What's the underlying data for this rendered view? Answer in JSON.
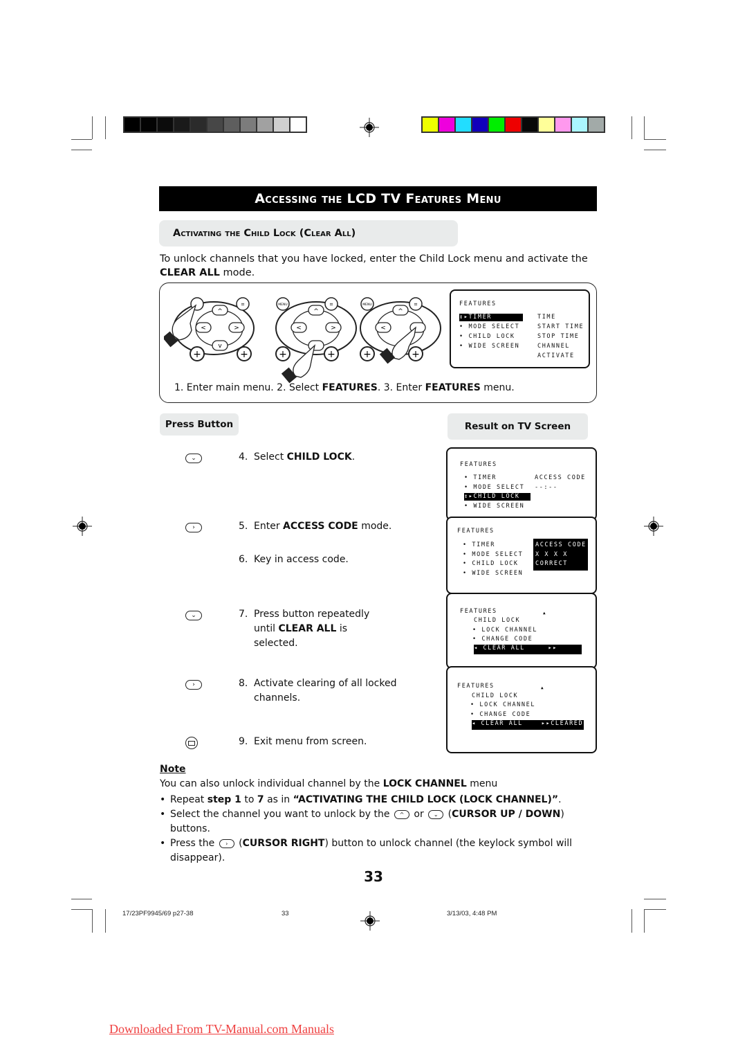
{
  "header": {
    "title": "Accessing the LCD TV Features Menu",
    "subtitle": "Activating the Child Lock (Clear All)"
  },
  "colors": {
    "grayscale_bar": [
      "#000000",
      "#030303",
      "#0c0c0c",
      "#1a1a1a",
      "#2b2b2b",
      "#474747",
      "#5e5e5e",
      "#7c7c7c",
      "#a1a1a1",
      "#cfcfcf",
      "#ffffff"
    ],
    "color_bar": [
      "#eeff00",
      "#ee00dd",
      "#22ddff",
      "#1100bb",
      "#00ee00",
      "#ee0000",
      "#080808",
      "#ffff99",
      "#ff99ee",
      "#aaf5ff",
      "#a2aaa8"
    ],
    "link": "#ef4040"
  },
  "intro": {
    "text": "To unlock channels that you have locked, enter the Child Lock menu and activate the",
    "bold": "CLEAR ALL",
    "suffix": " mode."
  },
  "setup_steps": {
    "remote_labels": {
      "menu": "MENU"
    },
    "caption": [
      {
        "pre": "1. Enter main menu.   2. Select ",
        "bold": "FEATURES",
        "post": ".   3. Enter "
      },
      {
        "bold": "FEATURES",
        "post": " menu."
      }
    ],
    "osd": {
      "title": "FEATURES",
      "items": [
        "TIMER",
        "MODE SELECT",
        "CHILD LOCK",
        "WIDE SCREEN"
      ],
      "selected": "TIMER",
      "sub_items": [
        "TIME",
        "START TIME",
        "STOP TIME",
        "CHANNEL",
        "ACTIVATE"
      ]
    }
  },
  "columns": {
    "press_button": "Press Button",
    "result": "Result on TV Screen"
  },
  "steps": [
    {
      "num": "4.",
      "pre": "Select ",
      "bold": "CHILD LOCK",
      "post": ".",
      "icon": "cursor-down"
    },
    {
      "num": "5.",
      "pre": "Enter ",
      "bold": "ACCESS CODE",
      "post": " mode.",
      "icon": "cursor-right"
    },
    {
      "num": "6.",
      "pre": "Key in access code.",
      "bold": "",
      "post": "",
      "icon": ""
    },
    {
      "num": "7.",
      "pre": "Press button repeatedly until ",
      "bold": "CLEAR ALL",
      "post": " is selected.",
      "icon": "cursor-down"
    },
    {
      "num": "8.",
      "pre": "Activate clearing of all locked channels.",
      "bold": "",
      "post": "",
      "icon": "cursor-right"
    },
    {
      "num": "9.",
      "pre": "Exit menu from screen.",
      "bold": "",
      "post": "",
      "icon": "osd-exit"
    }
  ],
  "screens": [
    {
      "title": "FEATURES",
      "items": [
        "• TIMER",
        "• MODE SELECT",
        "CHILD LOCK",
        "• WIDE SCREEN"
      ],
      "selected": "CHILD LOCK",
      "right": [
        "ACCESS CODE",
        "--:--"
      ]
    },
    {
      "title": "FEATURES",
      "items": [
        "• TIMER",
        "• MODE SELECT",
        "• CHILD LOCK",
        "• WIDE SCREEN"
      ],
      "right": [
        "ACCESS CODE",
        "X X X X",
        "CORRECT"
      ]
    },
    {
      "title": "FEATURES",
      "heading": "CHILD LOCK",
      "items": [
        "• LOCK CHANNEL",
        "• CHANGE CODE"
      ],
      "selected": "CLEAR ALL",
      "selected_suffix": "",
      "marker": "▲"
    },
    {
      "title": "FEATURES",
      "heading": "CHILD LOCK",
      "items": [
        "• LOCK CHANNEL",
        "• CHANGE CODE"
      ],
      "selected": "CLEAR ALL",
      "selected_suffix": "CLEARED",
      "marker": "▲"
    }
  ],
  "note": {
    "heading": "Note",
    "text_pre": "You can also unlock individual channel by the ",
    "text_bold": "LOCK CHANNEL",
    "text_post": " menu",
    "bullets": [
      {
        "p1": "Repeat ",
        "b1": "step 1",
        "p2": " to ",
        "b2": "7",
        "p3": " as in ",
        "b3": "“ACTIVATING THE CHILD LOCK (LOCK CHANNEL)”",
        "p4": "."
      },
      {
        "p1": "Select the channel you want to unlock by the",
        "p2": "or",
        "b1": "CURSOR UP / DOWN",
        "p3": "buttons."
      },
      {
        "p1": "Press the",
        "b1": "CURSOR RIGHT",
        "p2": "button to unlock channel (the keylock symbol will disappear)."
      }
    ]
  },
  "page_number": "33",
  "footer": {
    "file": "17/23PF9945/69 p27-38",
    "page": "33",
    "date": "3/13/03, 4:48 PM"
  },
  "download_link": "Downloaded From TV-Manual.com Manuals"
}
